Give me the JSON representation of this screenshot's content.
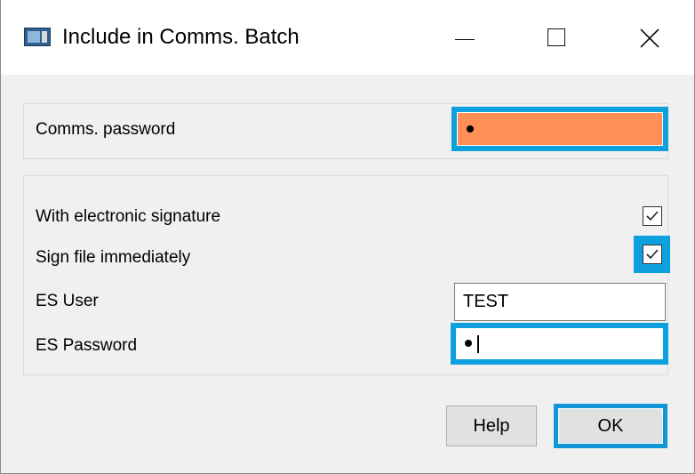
{
  "window": {
    "title": "Include in Comms. Batch",
    "icons": {
      "app": "app-window-icon",
      "minimize": "minimize-icon",
      "maximize": "maximize-icon",
      "close": "close-icon"
    }
  },
  "comms": {
    "password_label": "Comms. password",
    "password_masked": "•",
    "field_color": "#ff8f56",
    "focus_color": "#0da0df"
  },
  "signature": {
    "with_es_label": "With electronic signature",
    "with_es_checked": true,
    "sign_immediately_label": "Sign file immediately",
    "sign_immediately_checked": true,
    "es_user_label": "ES User",
    "es_user_value": "TEST",
    "es_password_label": "ES Password",
    "es_password_masked": "•"
  },
  "buttons": {
    "help_label": "Help",
    "ok_label": "OK"
  }
}
